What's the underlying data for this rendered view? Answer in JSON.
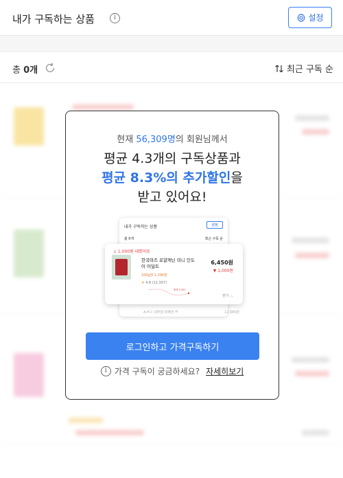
{
  "header": {
    "title": "내가 구독하는 상품",
    "info_glyph": "i",
    "settings_label": "설정"
  },
  "subbar": {
    "total_prefix": "총 ",
    "total_count": "0개",
    "sort_label": "최근 구독 순"
  },
  "modal": {
    "intro_prefix": "현재 ",
    "member_count": "56,309명",
    "intro_suffix": "의 회원님께서",
    "headline_line1": "평균 4.3개의 구독상품과",
    "headline_highlight": "평균 8.3%의 추가할인",
    "headline_particle": "을",
    "headline_line3": "받고 있어요!",
    "cta_label": "로그인하고 가격구독하기",
    "help_glyph": "i",
    "help_text": "가격 구독이 궁금하세요?",
    "help_link": "자세히보기",
    "preview": {
      "title": "내가 구독하는 상품",
      "settings": "설정",
      "total": "총 6개",
      "sort": "최근 구독 순",
      "discount": "↓ 1,000원 내렸어요",
      "product_name": "한국마즈 로얄캐닌 미니 인도어 어덜트",
      "unit_price": "100g당 1,290원",
      "rating_star": "★",
      "rating": "4.8 (12,357)",
      "price": "6,450원",
      "price_down": "▼ 1,000원",
      "chart_label": "최저 5,450",
      "close": "닫기 ︿",
      "sub_name": "A.H.C 내추럴 퍼펙션 커",
      "sub_price": "12,380원"
    }
  },
  "colors": {
    "accent": "#3a82f0",
    "highlight_text": "#2f74e6",
    "discount_red": "#e23a3a"
  },
  "icons": {
    "info": "info-icon",
    "settings": "gear-icon",
    "refresh": "refresh-icon",
    "sort": "sort-icon"
  }
}
